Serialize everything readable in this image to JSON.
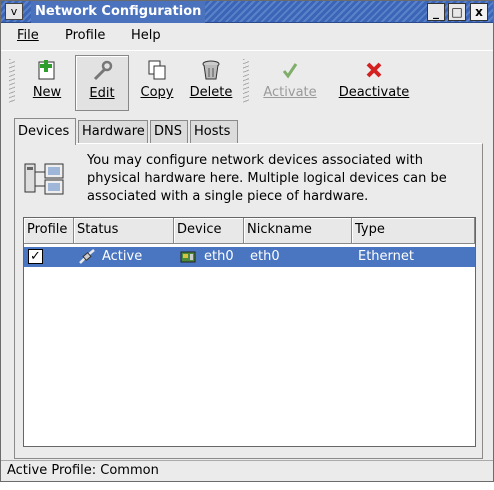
{
  "window": {
    "title": "Network Configuration",
    "menu_glyph": "v",
    "minimize_glyph": "_",
    "maximize_glyph": "□",
    "close_glyph": "x"
  },
  "menubar": {
    "file": "File",
    "profile": "Profile",
    "help": "Help"
  },
  "toolbar": {
    "new": "New",
    "edit": "Edit",
    "copy": "Copy",
    "delete": "Delete",
    "activate": "Activate",
    "deactivate": "Deactivate"
  },
  "tabs": {
    "devices": "Devices",
    "hardware": "Hardware",
    "dns": "DNS",
    "hosts": "Hosts",
    "active": "devices"
  },
  "description": "You may configure network devices associated with physical hardware here.  Multiple logical devices can be associated with a single piece of hardware.",
  "table": {
    "columns": {
      "profile": "Profile",
      "status": "Status",
      "device": "Device",
      "nickname": "Nickname",
      "type": "Type"
    },
    "rows": [
      {
        "profile_checked": "✓",
        "status": "Active",
        "device": "eth0",
        "nickname": "eth0",
        "type": "Ethernet"
      }
    ]
  },
  "statusbar": {
    "text": "Active Profile: Common"
  },
  "colors": {
    "title_bar": "#4b72bd",
    "selection": "#4a75c0",
    "window_bg": "#ebebeb"
  }
}
